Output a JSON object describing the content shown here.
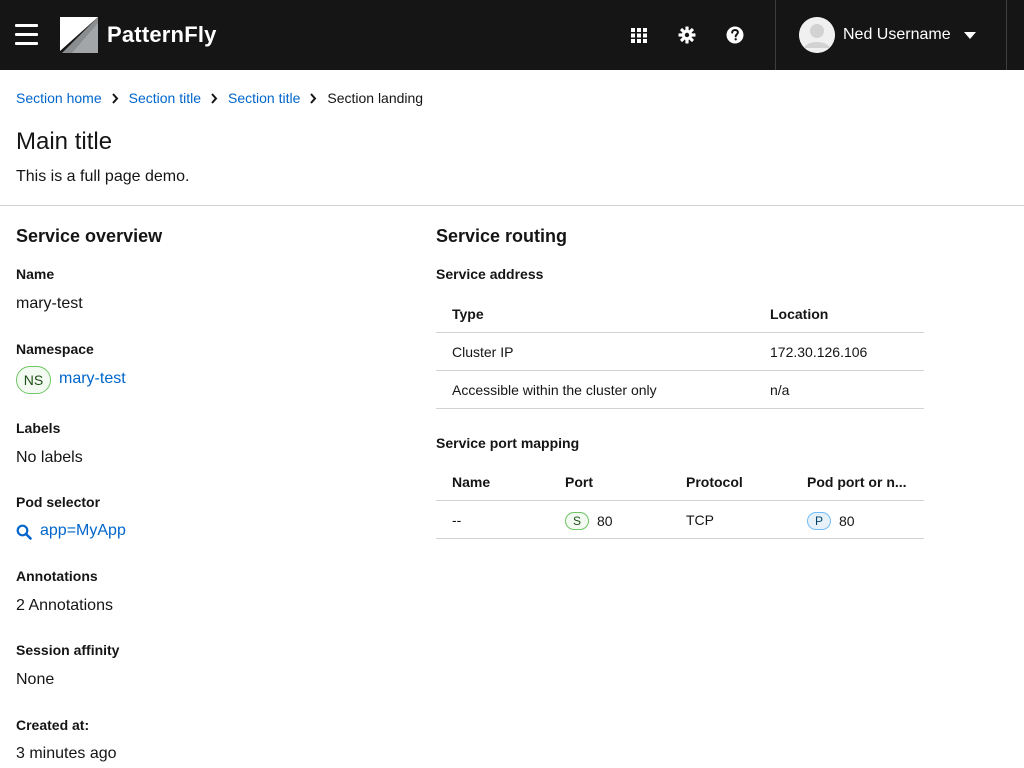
{
  "header": {
    "brand": "PatternFly",
    "user_name": "Ned Username"
  },
  "breadcrumb": [
    {
      "label": "Section home"
    },
    {
      "label": "Section title"
    },
    {
      "label": "Section title"
    },
    {
      "label": "Section landing"
    }
  ],
  "page": {
    "title": "Main title",
    "subtitle": "This is a full page demo."
  },
  "overview": {
    "heading": "Service overview",
    "name_label": "Name",
    "name_value": "mary-test",
    "namespace_label": "Namespace",
    "namespace_badge": "NS",
    "namespace_value": "mary-test",
    "labels_label": "Labels",
    "labels_value": "No labels",
    "pod_selector_label": "Pod selector",
    "pod_selector_value": "app=MyApp",
    "annotations_label": "Annotations",
    "annotations_value": "2 Annotations",
    "session_affinity_label": "Session affinity",
    "session_affinity_value": "None",
    "created_label": "Created at:",
    "created_value": "3 minutes ago"
  },
  "routing": {
    "heading": "Service routing",
    "address_heading": "Service address",
    "address_table": {
      "columns": [
        "Type",
        "Location"
      ],
      "rows": [
        [
          "Cluster IP",
          "172.30.126.106"
        ],
        [
          "Accessible within the cluster only",
          "n/a"
        ]
      ]
    },
    "port_heading": "Service port mapping",
    "port_table": {
      "columns": [
        "Name",
        "Port",
        "Protocol",
        "Pod port or n..."
      ],
      "rows": [
        {
          "name": "--",
          "port_badge": "S",
          "port": "80",
          "protocol": "TCP",
          "pod_port_badge": "P",
          "pod_port": "80"
        }
      ]
    }
  },
  "icons": {
    "menu": "hamburger-icon",
    "apps": "grid-icon",
    "settings": "gear-icon",
    "help": "question-circle-icon",
    "user_menu": "caret-down-icon",
    "separator": "angle-right-icon",
    "search": "search-icon"
  },
  "colors": {
    "masthead": "#151515",
    "link": "#0066cc",
    "badge_green": "#6ec664",
    "badge_blue": "#73bcf7"
  }
}
